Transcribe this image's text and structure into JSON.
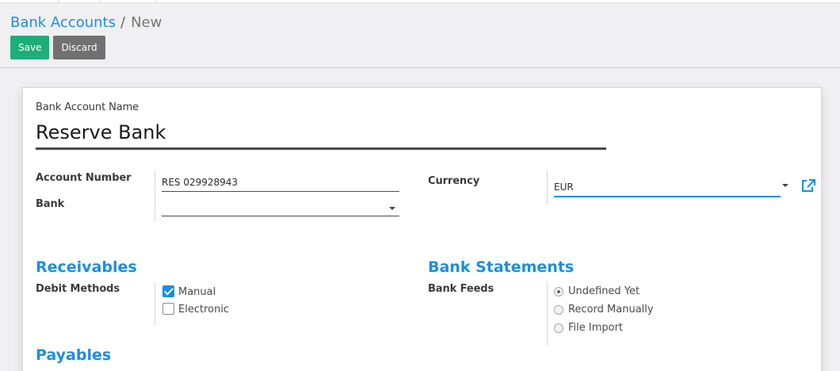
{
  "breadcrumb": {
    "parent": "Bank Accounts",
    "separator": "/",
    "current": "New"
  },
  "toolbar": {
    "save_label": "Save",
    "discard_label": "Discard"
  },
  "form": {
    "name_label": "Bank Account Name",
    "name_value": "Reserve Bank",
    "account_number_label": "Account Number",
    "account_number_value": "RES 029928943",
    "bank_label": "Bank",
    "bank_value": "",
    "currency_label": "Currency",
    "currency_value": "EUR"
  },
  "receivables": {
    "title": "Receivables",
    "debit_methods_label": "Debit Methods",
    "options": [
      {
        "label": "Manual",
        "checked": true
      },
      {
        "label": "Electronic",
        "checked": false
      }
    ]
  },
  "bank_statements": {
    "title": "Bank Statements",
    "bank_feeds_label": "Bank Feeds",
    "options": [
      {
        "label": "Undefined Yet",
        "selected": true
      },
      {
        "label": "Record Manually",
        "selected": false
      },
      {
        "label": "File Import",
        "selected": false
      }
    ]
  },
  "payables": {
    "title": "Payables"
  },
  "colors": {
    "accent": "#1b8fe0",
    "save": "#1dae7a",
    "discard": "#717171"
  },
  "icons": {
    "currency_link": "external-link-icon",
    "dropdown": "caret-down-icon",
    "check": "checkmark-icon"
  }
}
